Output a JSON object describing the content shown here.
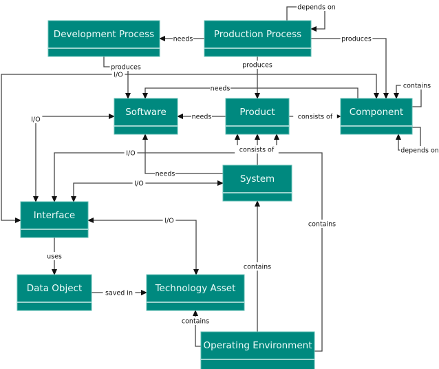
{
  "colors": {
    "node_fill": "#00897f",
    "node_border": "#5fbdb3",
    "node_text": "#ecfbf9",
    "edge": "#444444"
  },
  "nodes": [
    {
      "id": "dev",
      "label": "Development Process"
    },
    {
      "id": "prod_proc",
      "label": "Production Process"
    },
    {
      "id": "software",
      "label": "Software"
    },
    {
      "id": "product",
      "label": "Product"
    },
    {
      "id": "component",
      "label": "Component"
    },
    {
      "id": "system",
      "label": "System"
    },
    {
      "id": "interface",
      "label": "Interface"
    },
    {
      "id": "data_object",
      "label": "Data Object"
    },
    {
      "id": "tech_asset",
      "label": "Technology Asset"
    },
    {
      "id": "op_env",
      "label": "Operating Environment"
    }
  ],
  "edges": [
    {
      "from": "prod_proc",
      "to": "dev",
      "label": "needs"
    },
    {
      "from": "prod_proc",
      "to": "prod_proc",
      "label": "depends on"
    },
    {
      "from": "prod_proc",
      "to": "component",
      "label": "produces"
    },
    {
      "from": "prod_proc",
      "to": "product",
      "label": "produces"
    },
    {
      "from": "dev",
      "to": "software",
      "label": "produces"
    },
    {
      "from": "interface",
      "to": "component",
      "label": "I/O"
    },
    {
      "from": "component",
      "to": "software",
      "label": "needs"
    },
    {
      "from": "component",
      "to": "component",
      "label": "contains"
    },
    {
      "from": "component",
      "to": "component",
      "label": "depends on"
    },
    {
      "from": "product",
      "to": "software",
      "label": "needs"
    },
    {
      "from": "product",
      "to": "component",
      "label": "consists of"
    },
    {
      "from": "system",
      "to": "product",
      "label": "consists of"
    },
    {
      "from": "op_env",
      "to": "product",
      "label": "contains"
    },
    {
      "from": "interface",
      "to": "product",
      "label": "I/O"
    },
    {
      "from": "system",
      "to": "software",
      "label": "needs"
    },
    {
      "from": "interface",
      "to": "software",
      "label": "I/O"
    },
    {
      "from": "interface",
      "to": "system",
      "label": "I/O"
    },
    {
      "from": "interface",
      "to": "tech_asset",
      "label": "I/O"
    },
    {
      "from": "interface",
      "to": "data_object",
      "label": "uses"
    },
    {
      "from": "data_object",
      "to": "tech_asset",
      "label": "saved in"
    },
    {
      "from": "op_env",
      "to": "tech_asset",
      "label": "contains"
    },
    {
      "from": "op_env",
      "to": "system",
      "label": "contains"
    }
  ]
}
